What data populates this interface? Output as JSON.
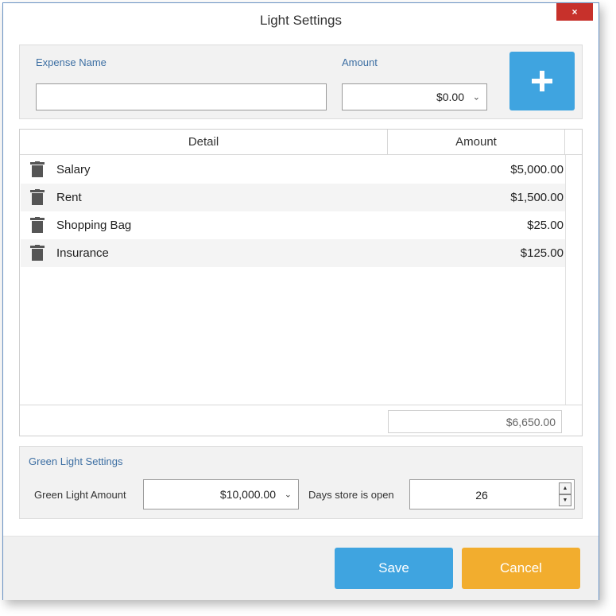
{
  "window": {
    "title": "Light Settings",
    "close_label": "×"
  },
  "entry": {
    "expense_name_label": "Expense Name",
    "expense_name_value": "",
    "amount_label": "Amount",
    "amount_value": "$0.00",
    "add_icon": "plus-icon"
  },
  "grid": {
    "columns": [
      "Detail",
      "Amount"
    ],
    "rows": [
      {
        "detail": "Salary",
        "amount": "$5,000.00"
      },
      {
        "detail": "Rent",
        "amount": "$1,500.00"
      },
      {
        "detail": "Shopping Bag",
        "amount": "$25.00"
      },
      {
        "detail": "Insurance",
        "amount": "$125.00"
      }
    ],
    "total": "$6,650.00"
  },
  "green_light": {
    "title": "Green Light Settings",
    "amount_label": "Green Light Amount",
    "amount_value": "$10,000.00",
    "days_label": "Days store is open",
    "days_value": "26"
  },
  "buttons": {
    "save": "Save",
    "cancel": "Cancel"
  },
  "colors": {
    "accent_blue": "#3fa4e0",
    "cancel_orange": "#f2ad2e",
    "close_red": "#c7312b"
  }
}
